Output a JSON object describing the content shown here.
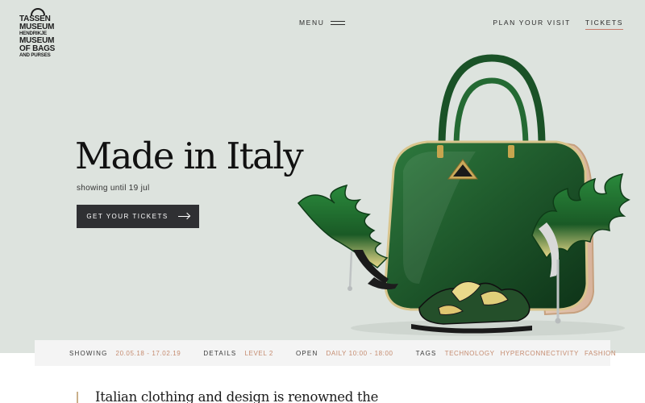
{
  "logo": {
    "lines": [
      "TASSEN",
      "MUSEUM",
      "HENDRIKJE",
      "MUSEUM",
      "OF BAGS",
      "AND PURSES"
    ]
  },
  "nav": {
    "menu_label": "MENU",
    "plan_visit": "PLAN YOUR VISIT",
    "tickets": "TICKETS"
  },
  "hero": {
    "title": "Made in Italy",
    "subtitle": "showing until 19 jul",
    "cta_label": "GET YOUR TICKETS"
  },
  "info": {
    "showing_label": "SHOWING",
    "showing_value": "20.05.18 - 17.02.19",
    "details_label": "DETAILS",
    "details_value": "LEVEL 2",
    "open_label": "OPEN",
    "open_value": "DAILY 10:00 - 18:00",
    "tags_label": "TAGS",
    "tags": [
      "TECHNOLOGY",
      "HYPERCONNECTIVITY",
      "FASHION"
    ]
  },
  "intro": {
    "text": "Italian clothing and design is renowned the"
  },
  "colors": {
    "hero_bg": "#dde3de",
    "accent": "#c58b6f",
    "button_bg": "#2f3033",
    "bag_green": "#1f5a2c"
  },
  "icons": {
    "menu": "hamburger-icon",
    "cta": "arrow-right-icon"
  }
}
